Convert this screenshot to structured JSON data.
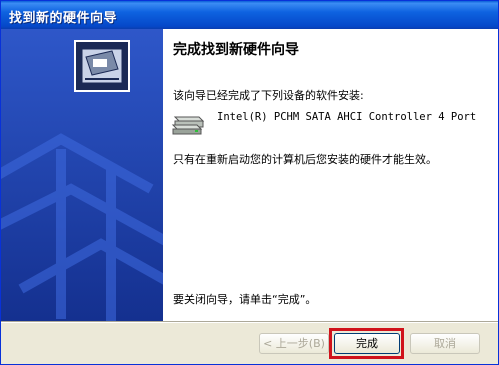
{
  "window": {
    "title": "找到新的硬件向导"
  },
  "content": {
    "heading": "完成找到新硬件向导",
    "line1": "该向导已经完成了下列设备的软件安装:",
    "device_name": "Intel(R) PCHM SATA AHCI Controller 4 Port",
    "note": "只有在重新启动您的计算机后您安装的硬件才能生效。",
    "close_hint": "要关闭向导，请单击“完成”。"
  },
  "buttons": {
    "back": "< 上一步(B)",
    "finish": "完成",
    "cancel": "取消"
  },
  "icons": [
    "hardware-wizard-icon",
    "device-icon"
  ],
  "colors": {
    "titlebar": "#0548c9",
    "sidebar": "#1a3aa8",
    "highlight": "#d0121b"
  }
}
